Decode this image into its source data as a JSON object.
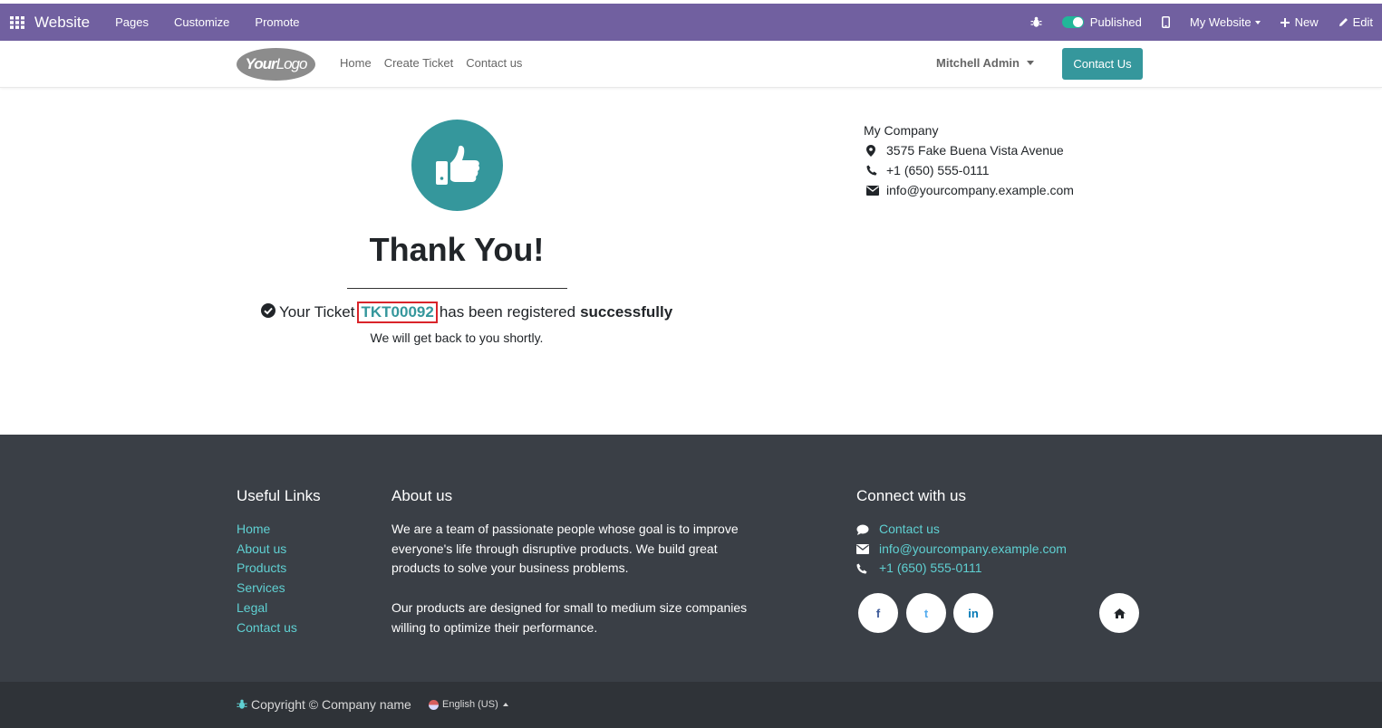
{
  "admin_bar": {
    "brand": "Website",
    "menu": [
      "Pages",
      "Customize",
      "Promote"
    ],
    "published_label": "Published",
    "website_label": "My Website",
    "new_label": "New",
    "edit_label": "Edit",
    "bg_color": "#7160a0"
  },
  "header": {
    "logo_bold": "Your",
    "logo_light": "Logo",
    "nav": [
      "Home",
      "Create Ticket",
      "Contact us"
    ],
    "user": "Mitchell Admin",
    "contact_button": "Contact Us",
    "accent": "#35979c"
  },
  "main": {
    "title": "Thank You!",
    "ticket_prefix": "Your Ticket",
    "ticket_code": "TKT00092",
    "ticket_suffix": "has been registered",
    "ticket_bold": "successfully",
    "subtitle": "We will get back to you shortly."
  },
  "company": {
    "name": "My Company",
    "address": "3575 Fake Buena Vista Avenue",
    "phone": "+1 (650) 555-0111",
    "email": "info@yourcompany.example.com"
  },
  "footer": {
    "useful_links_title": "Useful Links",
    "useful_links": [
      "Home",
      "About us",
      "Products",
      "Services",
      "Legal",
      "Contact us"
    ],
    "about_title": "About us",
    "about_p1": "We are a team of passionate people whose goal is to improve everyone's life through disruptive products. We build great products to solve your business problems.",
    "about_p2": "Our products are designed for small to medium size companies willing to optimize their performance.",
    "connect_title": "Connect with us",
    "connect_contact": "Contact us",
    "connect_email": "info@yourcompany.example.com",
    "connect_phone": "+1 (650) 555-0111",
    "social": [
      "f",
      "t",
      "in"
    ]
  },
  "copyright": {
    "text": "Copyright © Company name",
    "language": "English (US)"
  }
}
